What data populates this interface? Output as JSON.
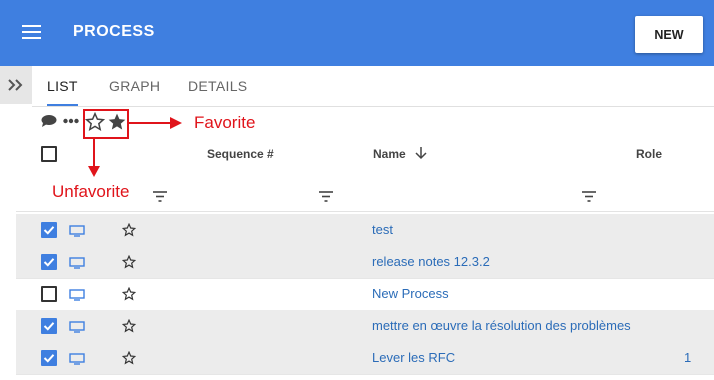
{
  "appbar": {
    "title": "PROCESS",
    "new_label": "NEW"
  },
  "tabs": [
    {
      "label": "LIST",
      "active": true
    },
    {
      "label": "GRAPH",
      "active": false
    },
    {
      "label": "DETAILS",
      "active": false
    }
  ],
  "annotations": {
    "favorite": "Favorite",
    "unfavorite": "Unfavorite"
  },
  "columns": {
    "sequence": "Sequence #",
    "name": "Name",
    "role": "Role"
  },
  "rows": [
    {
      "name": "test",
      "role": "",
      "checked": true
    },
    {
      "name": "release notes 12.3.2",
      "role": "",
      "checked": true
    },
    {
      "name": "New Process",
      "role": "",
      "checked": false
    },
    {
      "name": "mettre en œuvre la résolution des problèmes",
      "role": "",
      "checked": true
    },
    {
      "name": "Lever les RFC",
      "role": "1",
      "checked": true
    }
  ],
  "colors": {
    "primary": "#3f7fe0",
    "annotation": "#e0141b",
    "link": "#2b6cb8"
  }
}
